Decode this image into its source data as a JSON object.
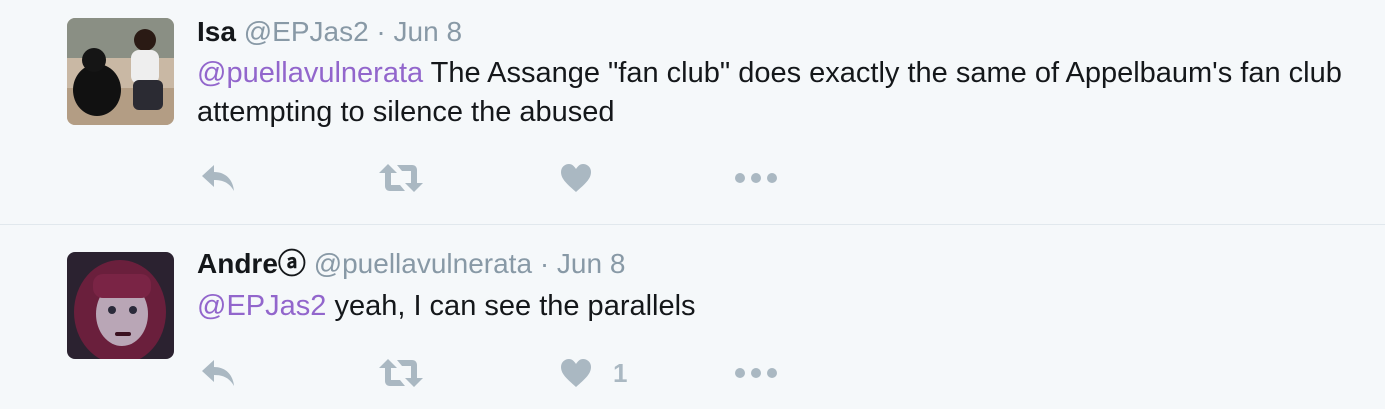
{
  "tweets": [
    {
      "name": "Isa",
      "handle": "@EPJas2",
      "separator": "·",
      "date": "Jun 8",
      "mention": "@puellavulnerata",
      "text": " The Assange \"fan club\" does exactly the same of Appelbaum's fan club attempting to silence the abused",
      "like_count": ""
    },
    {
      "name": "Andreⓐ",
      "handle": "@puellavulnerata",
      "separator": "·",
      "date": "Jun 8",
      "mention": "@EPJas2",
      "text": " yeah, I can see the parallels",
      "like_count": "1"
    }
  ],
  "icons": {
    "reply": "reply-icon",
    "retweet": "retweet-icon",
    "like": "heart-icon",
    "more": "more-icon"
  },
  "colors": {
    "background": "#f5f8fa",
    "mention": "#9266cc",
    "meta": "#8899a6",
    "icon": "#aab8c2"
  }
}
